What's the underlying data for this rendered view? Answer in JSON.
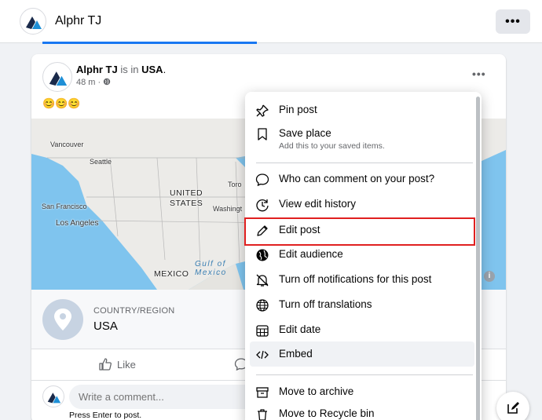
{
  "header": {
    "title": "Alphr TJ",
    "more_label": "•••"
  },
  "post": {
    "author": "Alphr TJ",
    "connector": "is in",
    "location": "USA",
    "time": "48 m",
    "emojis": "😊😊😊",
    "more_label": "•••"
  },
  "map": {
    "labels": {
      "vancouver": "Vancouver",
      "seattle": "Seattle",
      "united": "UNITED",
      "states": "STATES",
      "toronto": "Toro",
      "sanfrancisco": "San Francisco",
      "losangeles": "Los Angeles",
      "washington": "Washingt",
      "gulf1": "Gulf of",
      "gulf2": "Mexico",
      "mexico": "MEXICO"
    },
    "info": "i"
  },
  "place": {
    "category": "COUNTRY/REGION",
    "value": "USA"
  },
  "actions": {
    "like_label": "Like"
  },
  "comment": {
    "placeholder": "Write a comment...",
    "hint": "Press Enter to post."
  },
  "menu": {
    "items": [
      {
        "label": "Pin post",
        "icon": "pin-icon"
      },
      {
        "label": "Save place",
        "sub": "Add this to your saved items.",
        "icon": "bookmark-icon"
      },
      {
        "label": "Who can comment on your post?",
        "icon": "comment-bubble-icon"
      },
      {
        "label": "View edit history",
        "icon": "history-icon"
      },
      {
        "label": "Edit post",
        "icon": "pencil-icon"
      },
      {
        "label": "Edit audience",
        "icon": "globe-filled-icon"
      },
      {
        "label": "Turn off notifications for this post",
        "icon": "bell-off-icon"
      },
      {
        "label": "Turn off translations",
        "icon": "translate-globe-icon"
      },
      {
        "label": "Edit date",
        "icon": "calendar-icon"
      },
      {
        "label": "Embed",
        "icon": "code-icon"
      },
      {
        "label": "Move to archive",
        "icon": "archive-icon"
      },
      {
        "label": "Move to Recycle bin",
        "icon": "trash-icon"
      }
    ]
  },
  "colors": {
    "highlight": "#e02020",
    "accent": "#1877f2"
  }
}
